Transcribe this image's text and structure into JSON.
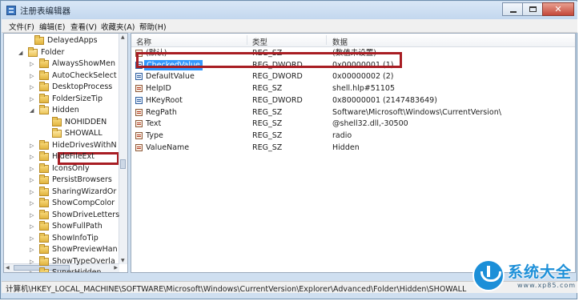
{
  "window": {
    "title": "注册表编辑器",
    "close_label": "✕"
  },
  "menu": [
    "文件(F)",
    "编辑(E)",
    "查看(V)",
    "收藏夹(A)",
    "帮助(H)"
  ],
  "tree": [
    {
      "label": "DelayedApps",
      "arrow": "",
      "open": false
    },
    {
      "label": "Folder",
      "arrow": "◢",
      "open": true
    },
    {
      "label": "AlwaysShowMen",
      "arrow": "▷",
      "open": false
    },
    {
      "label": "AutoCheckSelect",
      "arrow": "▷",
      "open": false
    },
    {
      "label": "DesktopProcess",
      "arrow": "▷",
      "open": false
    },
    {
      "label": "FolderSizeTip",
      "arrow": "▷",
      "open": false
    },
    {
      "label": "Hidden",
      "arrow": "◢",
      "open": true
    },
    {
      "label": "NOHIDDEN",
      "arrow": "",
      "open": false
    },
    {
      "label": "SHOWALL",
      "arrow": "",
      "open": true
    },
    {
      "label": "HideDrivesWithN",
      "arrow": "▷",
      "open": false
    },
    {
      "label": "HideFileExt",
      "arrow": "▷",
      "open": false
    },
    {
      "label": "IconsOnly",
      "arrow": "▷",
      "open": false
    },
    {
      "label": "PersistBrowsers",
      "arrow": "▷",
      "open": false
    },
    {
      "label": "SharingWizardOr",
      "arrow": "▷",
      "open": false
    },
    {
      "label": "ShowCompColor",
      "arrow": "▷",
      "open": false
    },
    {
      "label": "ShowDriveLetters",
      "arrow": "▷",
      "open": false
    },
    {
      "label": "ShowFullPath",
      "arrow": "▷",
      "open": false
    },
    {
      "label": "ShowInfoTip",
      "arrow": "▷",
      "open": false
    },
    {
      "label": "ShowPreviewHan",
      "arrow": "▷",
      "open": false
    },
    {
      "label": "ShowTypeOverla",
      "arrow": "▷",
      "open": false
    },
    {
      "label": "SuperHidden",
      "arrow": "▷",
      "open": false
    }
  ],
  "columns": {
    "name": "名称",
    "type": "类型",
    "data": "数据"
  },
  "values": [
    {
      "name": "(默认)",
      "type": "REG_SZ",
      "data": "(数值未设置)",
      "icon": "string"
    },
    {
      "name": "CheckedValue",
      "type": "REG_DWORD",
      "data": "0x00000001 (1)",
      "icon": "binary",
      "selected": true
    },
    {
      "name": "DefaultValue",
      "type": "REG_DWORD",
      "data": "0x00000002 (2)",
      "icon": "binary"
    },
    {
      "name": "HelpID",
      "type": "REG_SZ",
      "data": "shell.hlp#51105",
      "icon": "string"
    },
    {
      "name": "HKeyRoot",
      "type": "REG_DWORD",
      "data": "0x80000001 (2147483649)",
      "icon": "binary"
    },
    {
      "name": "RegPath",
      "type": "REG_SZ",
      "data": "Software\\Microsoft\\Windows\\CurrentVersion\\",
      "icon": "string"
    },
    {
      "name": "Text",
      "type": "REG_SZ",
      "data": "@shell32.dll,-30500",
      "icon": "string"
    },
    {
      "name": "Type",
      "type": "REG_SZ",
      "data": "radio",
      "icon": "string"
    },
    {
      "name": "ValueName",
      "type": "REG_SZ",
      "data": "Hidden",
      "icon": "string"
    }
  ],
  "status": "计算机\\HKEY_LOCAL_MACHINE\\SOFTWARE\\Microsoft\\Windows\\CurrentVersion\\Explorer\\Advanced\\Folder\\Hidden\\SHOWALL",
  "watermark": {
    "title": "系统大全",
    "url": "www.xp85.com"
  },
  "colors": {
    "highlight_box": "#a81d23",
    "selection": "#3399ff",
    "window_frame": "#cfdff0"
  }
}
